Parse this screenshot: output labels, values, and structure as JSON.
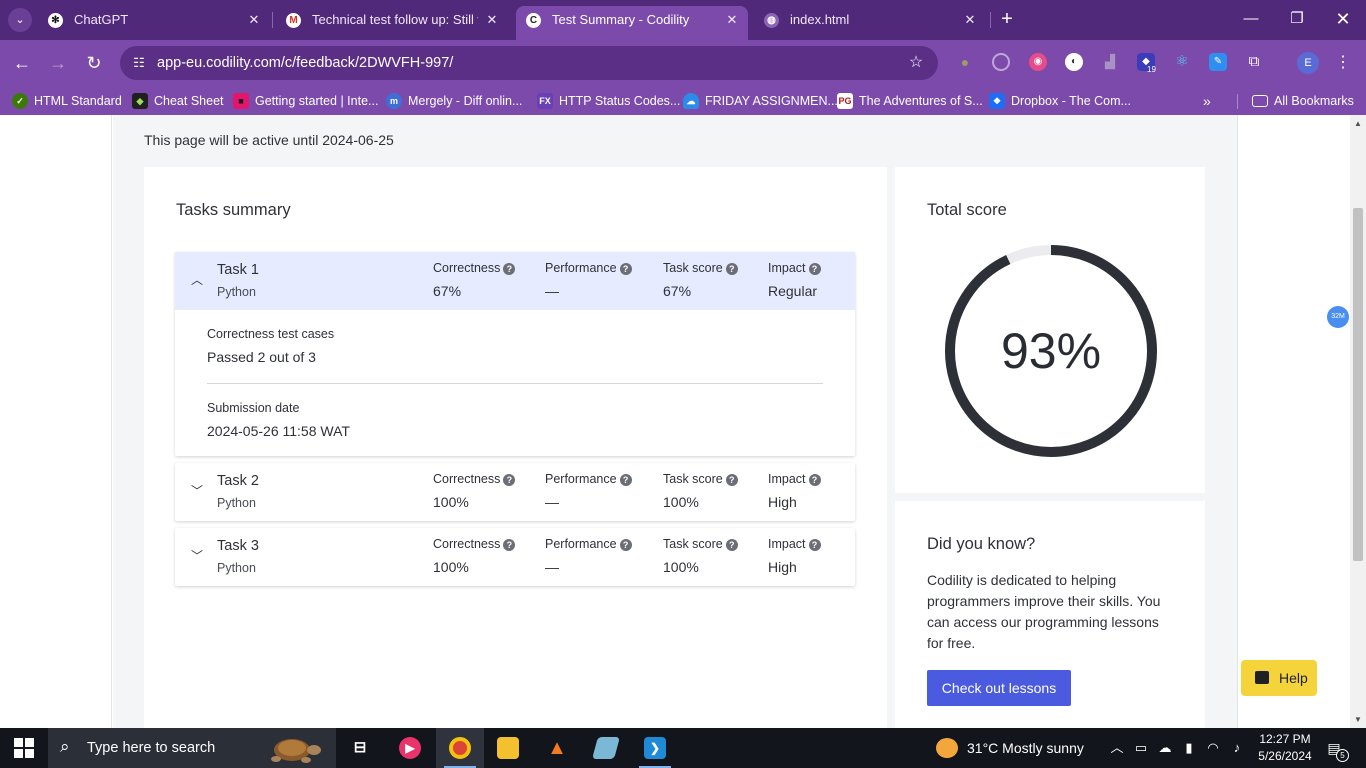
{
  "browser": {
    "tabs": [
      {
        "title": "ChatGPT",
        "icon": "chatgpt-icon"
      },
      {
        "title": "Technical test follow up: Still wa",
        "icon": "gmail-icon"
      },
      {
        "title": "Test Summary - Codility",
        "icon": "codility-icon"
      },
      {
        "title": "index.html",
        "icon": "globe-icon"
      }
    ],
    "url": "app-eu.codility.com/c/feedback/2DWVFH-997/",
    "extension_badge": "19",
    "profile_initial": "E",
    "bookmarks": [
      {
        "label": "HTML Standard",
        "icon": "whatwg-icon",
        "color": "#3c790a"
      },
      {
        "label": "Cheat Sheet",
        "icon": "cheatsheet-icon",
        "color": "#202020"
      },
      {
        "label": "Getting started | Inte...",
        "icon": "jetbrains-icon",
        "color": "#e3156c"
      },
      {
        "label": "Mergely - Diff onlin...",
        "icon": "mergely-icon",
        "color": "#3d6fd6"
      },
      {
        "label": "HTTP Status Codes...",
        "icon": "fx-icon",
        "color": "#6a3fb6"
      },
      {
        "label": "FRIDAY ASSIGNMEN...",
        "icon": "onedrive-icon",
        "color": "#2a8be8"
      },
      {
        "label": "The Adventures of S...",
        "icon": "pg-icon",
        "color": "#ffffff"
      },
      {
        "label": "Dropbox - The Com...",
        "icon": "dropbox-icon",
        "color": "#1f6cf5"
      }
    ],
    "all_bookmarks": "All Bookmarks"
  },
  "page": {
    "active_note": "This page will be active until 2024-06-25",
    "tasks_title": "Tasks summary",
    "metric_labels": {
      "correctness": "Correctness",
      "performance": "Performance",
      "task_score": "Task score",
      "impact": "Impact"
    },
    "tasks": [
      {
        "name": "Task 1",
        "language": "Python",
        "correctness": "67%",
        "performance": "—",
        "task_score": "67%",
        "impact": "Regular",
        "expanded": true,
        "details": {
          "tests_label": "Correctness test cases",
          "tests_value": "Passed 2 out of 3",
          "date_label": "Submission date",
          "date_value": "2024-05-26 11:58 WAT"
        }
      },
      {
        "name": "Task 2",
        "language": "Python",
        "correctness": "100%",
        "performance": "—",
        "task_score": "100%",
        "impact": "High",
        "expanded": false
      },
      {
        "name": "Task 3",
        "language": "Python",
        "correctness": "100%",
        "performance": "—",
        "task_score": "100%",
        "impact": "High",
        "expanded": false
      }
    ],
    "total_score": {
      "title": "Total score",
      "value": "93%",
      "fraction": 0.93,
      "ring_color": "#2e3038",
      "track_color": "#ececee"
    },
    "did_you_know": {
      "title": "Did you know?",
      "text": "Codility is dedicated to helping programmers improve their skills. You can access our programming lessons for free.",
      "button": "Check out lessons"
    },
    "help_button": "Help",
    "scroll_badge": "32M",
    "accent": "#4a5be0"
  },
  "taskbar": {
    "search_placeholder": "Type here to search",
    "weather": "31°C  Mostly sunny",
    "time": "12:27 PM",
    "date": "5/26/2024",
    "notifications": "5"
  }
}
